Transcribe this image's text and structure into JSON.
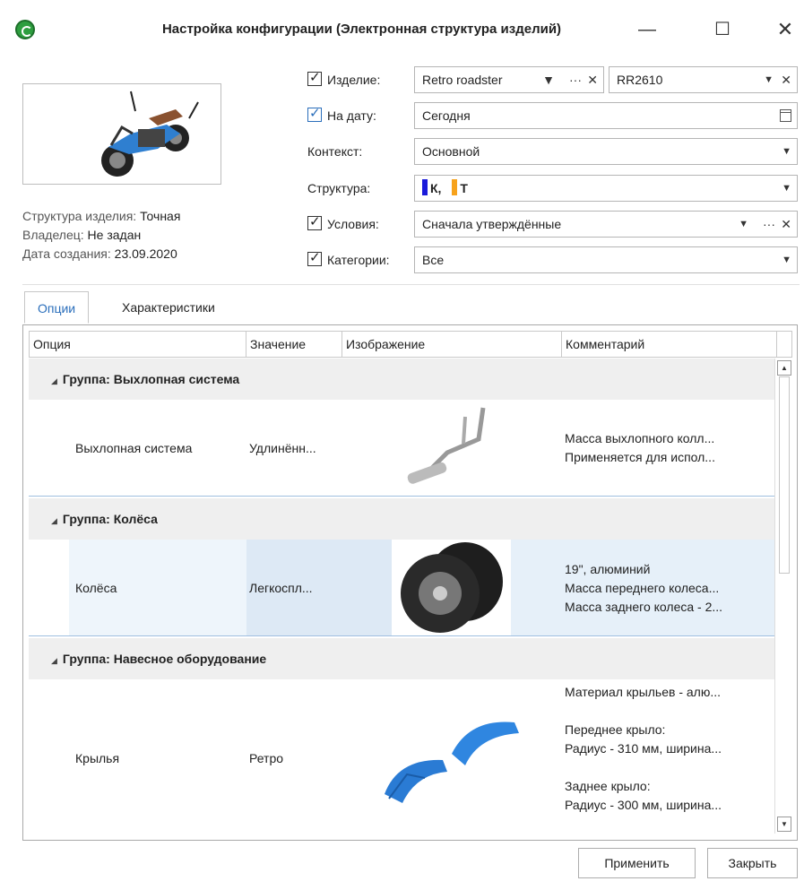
{
  "window": {
    "title": "Настройка конфигурации (Электронная структура изделий)"
  },
  "info": {
    "structure_label": "Структура изделия:",
    "structure_value": "Точная",
    "owner_label": "Владелец:",
    "owner_value": "Не задан",
    "created_label": "Дата создания:",
    "created_value": "23.09.2020"
  },
  "form": {
    "product_label": "Изделие:",
    "product_value": "Retro roadster",
    "product_code": "RR2610",
    "date_label": "На дату:",
    "date_value": "Сегодня",
    "context_label": "Контекст:",
    "context_value": "Основной",
    "structure_label": "Структура:",
    "structure_items": [
      "К,",
      "Т"
    ],
    "structure_colors": [
      "#1a1adb",
      "#f7a21b"
    ],
    "conditions_label": "Условия:",
    "conditions_value": "Сначала утверждённые",
    "categories_label": "Категории:",
    "categories_value": "Все"
  },
  "tabs": [
    "Опции",
    "Характеристики"
  ],
  "grid": {
    "columns": [
      "Опция",
      "Значение",
      "Изображение",
      "Комментарий"
    ],
    "groups": [
      {
        "title": "Группа: Выхлопная система",
        "row": {
          "option": "Выхлопная система",
          "value": "Удлинённ...",
          "image": "exhaust-system-image",
          "comments": [
            "Масса выхлопного колл...",
            "Применяется для испол..."
          ]
        }
      },
      {
        "title": "Группа: Колёса",
        "row": {
          "option": "Колёса",
          "value": "Легкоспл...",
          "image": "wheels-image",
          "comments": [
            "19\", алюминий",
            "Масса переднего колеса...",
            "Масса заднего колеса - 2..."
          ]
        }
      },
      {
        "title": "Группа: Навесное оборудование",
        "row": {
          "option": "Крылья",
          "value": "Ретро",
          "image": "fenders-image",
          "comments": [
            "Материал крыльев - алю...",
            "",
            "Переднее крыло:",
            "Радиус - 310 мм, ширина...",
            "",
            "Заднее крыло:",
            "Радиус - 300 мм, ширина..."
          ]
        }
      }
    ]
  },
  "buttons": {
    "apply": "Применить",
    "close": "Закрыть"
  }
}
